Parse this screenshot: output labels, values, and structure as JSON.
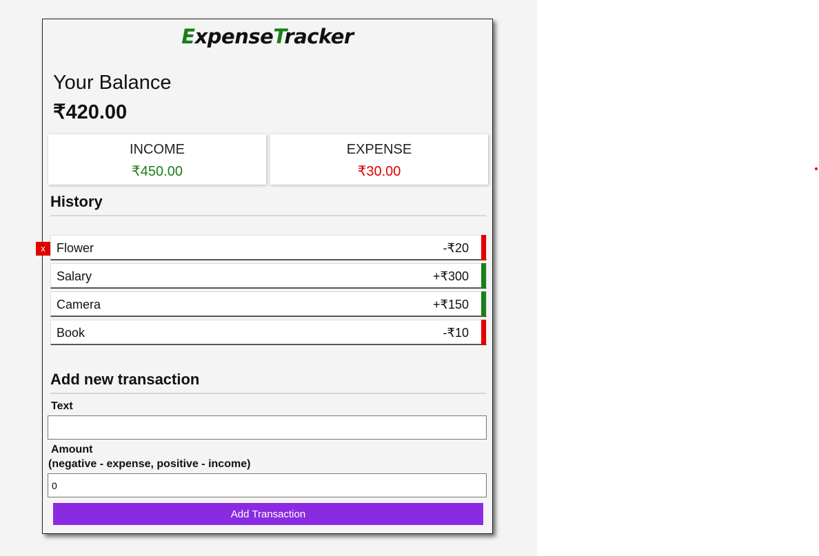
{
  "app": {
    "title_e": "E",
    "title_xpense": "xpense",
    "title_t": "T",
    "title_racker": "racker"
  },
  "balance": {
    "label": "Your Balance",
    "value": "₹420.00"
  },
  "summary": {
    "income_label": "INCOME",
    "income_value": "₹450.00",
    "expense_label": "EXPENSE",
    "expense_value": "₹30.00"
  },
  "history": {
    "heading": "History",
    "delete_label": "x",
    "items": [
      {
        "text": "Flower",
        "amount": "-₹20",
        "type": "minus"
      },
      {
        "text": "Salary",
        "amount": "+₹300",
        "type": "plus"
      },
      {
        "text": "Camera",
        "amount": "+₹150",
        "type": "plus"
      },
      {
        "text": "Book",
        "amount": "-₹10",
        "type": "minus"
      }
    ]
  },
  "form": {
    "heading": "Add new transaction",
    "text_label": "Text",
    "text_value": "",
    "amount_label_1": "Amount",
    "amount_label_2": "(negative - expense, positive - income)",
    "amount_value": "0",
    "submit_label": "Add Transaction"
  },
  "colors": {
    "income": "#1a7f1a",
    "expense": "#e00000",
    "accent": "#8a2be2"
  }
}
